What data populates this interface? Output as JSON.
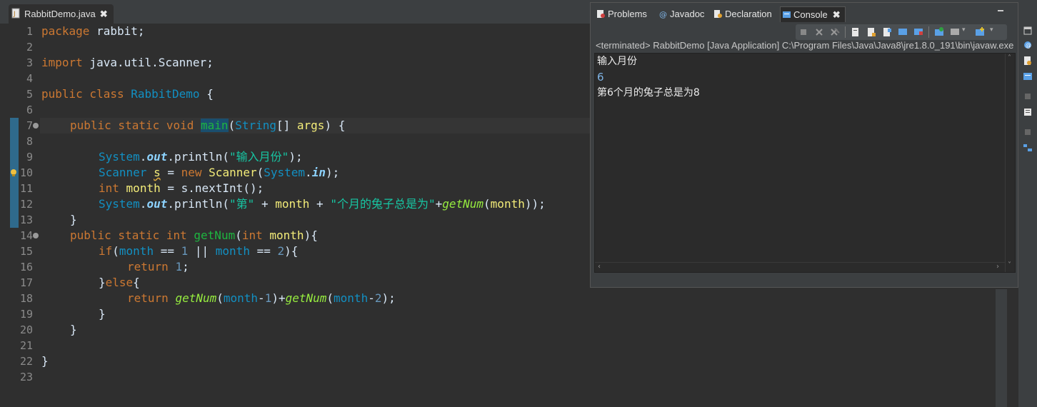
{
  "editor": {
    "tab_title": "RabbitDemo.java",
    "tab_close": "✖",
    "line_numbers": [
      "1",
      "2",
      "3",
      "4",
      "5",
      "6",
      "7",
      "8",
      "9",
      "10",
      "11",
      "12",
      "13",
      "14",
      "15",
      "16",
      "17",
      "18",
      "19",
      "20",
      "21",
      "22",
      "23"
    ],
    "code": {
      "l1": {
        "kw": "package",
        "rest": " rabbit;"
      },
      "l3": {
        "kw": "import",
        "rest": " java.util.Scanner;"
      },
      "l5": {
        "kw1": "public",
        "kw2": " class",
        "name": " RabbitDemo",
        "rest": " {"
      },
      "l7": {
        "kw": "public static void",
        "method": "main",
        "p1": "(",
        "type": "String",
        "arr": "[] ",
        "param": "args",
        "p2": ")",
        "rest": " {"
      },
      "l9": {
        "cls": "System",
        "dot1": ".",
        "field": "out",
        "call": ".println(",
        "str": "\"输入月份\"",
        "end": ");"
      },
      "l10": {
        "cls": "Scanner",
        "sp": " ",
        "var": "s",
        "eq": " = ",
        "kw": "new",
        "sp2": " ",
        "cls2": "Scanner",
        "p": "(",
        "cls3": "System",
        "dot": ".",
        "field": "in",
        "end": ");"
      },
      "l11": {
        "kw": "int",
        "sp": " ",
        "var": "month",
        "rest": " = s.nextInt();"
      },
      "l12": {
        "cls": "System",
        "dot": ".",
        "field": "out",
        "call": ".println(",
        "str1": "\"第\"",
        "op1": " + ",
        "v1": "month",
        "op2": " + ",
        "str2": "\"个月的兔子总是为\"",
        "op3": "+",
        "stat": "getNum",
        "p": "(",
        "v2": "month",
        "end": "));"
      },
      "l13": "}",
      "l14": {
        "kw": "public static int",
        "sp": " ",
        "method": "getNum",
        "p": "(",
        "kw2": "int",
        "sp2": " ",
        "var": "month",
        "end": "){"
      },
      "l15": {
        "kw": "if",
        "p": "(",
        "v1": "month",
        "op1": " == ",
        "n1": "1",
        "op2": " || ",
        "v2": "month",
        "op3": " == ",
        "n2": "2",
        "end": "){"
      },
      "l16": {
        "kw": "return",
        "sp": " ",
        "num": "1",
        "end": ";"
      },
      "l17": {
        "b1": "}",
        "kw": "else",
        "b2": "{"
      },
      "l18": {
        "kw": "return",
        "sp": " ",
        "s1": "getNum",
        "p1": "(",
        "v1": "month",
        "m1": "-",
        "n1": "1",
        "p2": ")+",
        "s2": "getNum",
        "p3": "(",
        "v2": "month",
        "m2": "-",
        "n2": "2",
        "end": ");"
      },
      "l19": "}",
      "l20": "}",
      "l22": "}"
    }
  },
  "console_view": {
    "tabs": [
      {
        "label": "Problems",
        "icon": "problems-icon"
      },
      {
        "label": "Javadoc",
        "icon": "javadoc-icon"
      },
      {
        "label": "Declaration",
        "icon": "declaration-icon"
      },
      {
        "label": "Console",
        "icon": "console-icon",
        "active": true
      }
    ],
    "tab_close": "✖",
    "status": "<terminated> RabbitDemo [Java Application] C:\\Program Files\\Java\\Java8\\jre1.8.0_191\\bin\\javaw.exe",
    "output": [
      {
        "text": "输入月份",
        "kind": "stdout"
      },
      {
        "text": "6",
        "kind": "stdin"
      },
      {
        "text": "第6个月的兔子总是为8",
        "kind": "stdout"
      }
    ]
  },
  "colors": {
    "background": "#2f2f2f",
    "keyword": "#cc7832",
    "class": "#1290c3",
    "string": "#17c6a3",
    "field": "#8dd3ff",
    "stdin": "#7fb4e6"
  }
}
